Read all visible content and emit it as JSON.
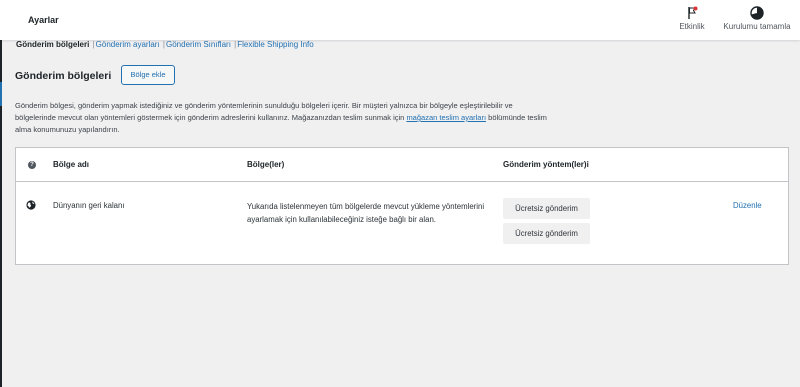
{
  "header": {
    "title": "Ayarlar",
    "activity_label": "Etkinlik",
    "setup_label": "Kurulumu tamamla"
  },
  "subnav": {
    "current": "Gönderim bölgeleri",
    "links": [
      "Gönderim ayarları",
      "Gönderim Sınıfları",
      "Flexible Shipping Info"
    ]
  },
  "zones": {
    "heading": "Gönderim bölgeleri",
    "add_button": "Bölge ekle",
    "description_text": "Gönderim bölgesi, gönderim yapmak istediğiniz ve gönderim yöntemlerinin sunulduğu bölgeleri içerir. Bir müşteri yalnızca bir bölgeyle eşleştirilebilir ve bölgelerinde mevcut olan yöntemleri göstermek için gönderim adreslerini kullanırız. Mağazanızdan teslim sunmak için ",
    "description_link": "mağazan teslim ayarları",
    "description_suffix": " bölümünde teslim alma konumunuzu yapılandırın."
  },
  "table": {
    "columns": [
      "Bölge adı",
      "Bölge(ler)",
      "Gönderim yöntem(ler)i"
    ],
    "rows": [
      {
        "name": "Dünyanın geri kalanı",
        "region": "Yukarıda listelenmeyen tüm bölgelerde mevcut yükleme yöntemlerini ayarlamak için kullanılabileceğiniz isteğe bağlı bir alan.",
        "methods": [
          "Ücretsiz gönderim",
          "Ücretsiz gönderim"
        ],
        "edit": "Düzenle"
      }
    ]
  },
  "colors": {
    "accent": "#2271b1",
    "background": "#f0f0f1",
    "header": "#ffffff"
  },
  "icons": [
    "flag-icon",
    "progress-circle-icon",
    "help-icon",
    "globe-icon"
  ]
}
